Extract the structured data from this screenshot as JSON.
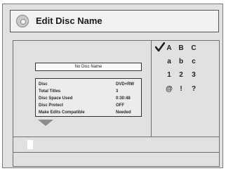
{
  "window": {
    "title": "Edit Disc Name"
  },
  "name_field": {
    "value": "No Disc Name"
  },
  "disc_info": {
    "rows": [
      {
        "label": "Disc",
        "value": "DVD+RW"
      },
      {
        "label": "Total Titles",
        "value": "3"
      },
      {
        "label": "Disc Space Used",
        "value": "0:30:48"
      },
      {
        "label": "Disc Protect",
        "value": "OFF"
      },
      {
        "label": "Make Edits Compatible",
        "value": "Needed"
      }
    ]
  },
  "keyboard": {
    "rows": [
      [
        "A",
        "B",
        "C"
      ],
      [
        "a",
        "b",
        "c"
      ],
      [
        "1",
        "2",
        "3"
      ],
      [
        "@",
        "!",
        "?"
      ]
    ],
    "selected_icon": "checkmark-icon"
  },
  "icons": {
    "header": "disc-icon",
    "scroll": "down-arrow-icon"
  }
}
